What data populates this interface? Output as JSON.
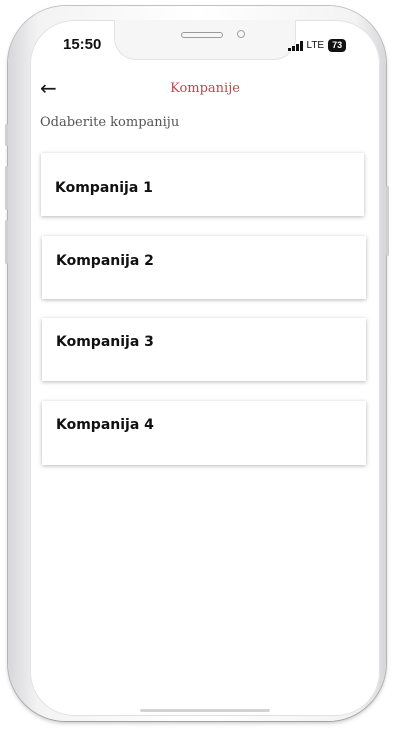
{
  "status_bar": {
    "time": "15:50",
    "network": "LTE",
    "battery": "73"
  },
  "header": {
    "back_icon": "arrow-left-icon",
    "title": "Kompanije"
  },
  "subtitle": "Odaberite kompaniju",
  "companies": [
    {
      "label": "Kompanija 1"
    },
    {
      "label": "Kompanija 2"
    },
    {
      "label": "Kompanija 3"
    },
    {
      "label": "Kompanija 4"
    }
  ],
  "colors": {
    "accent": "#c0474d",
    "background": "#ffffff",
    "text": "#111111"
  }
}
